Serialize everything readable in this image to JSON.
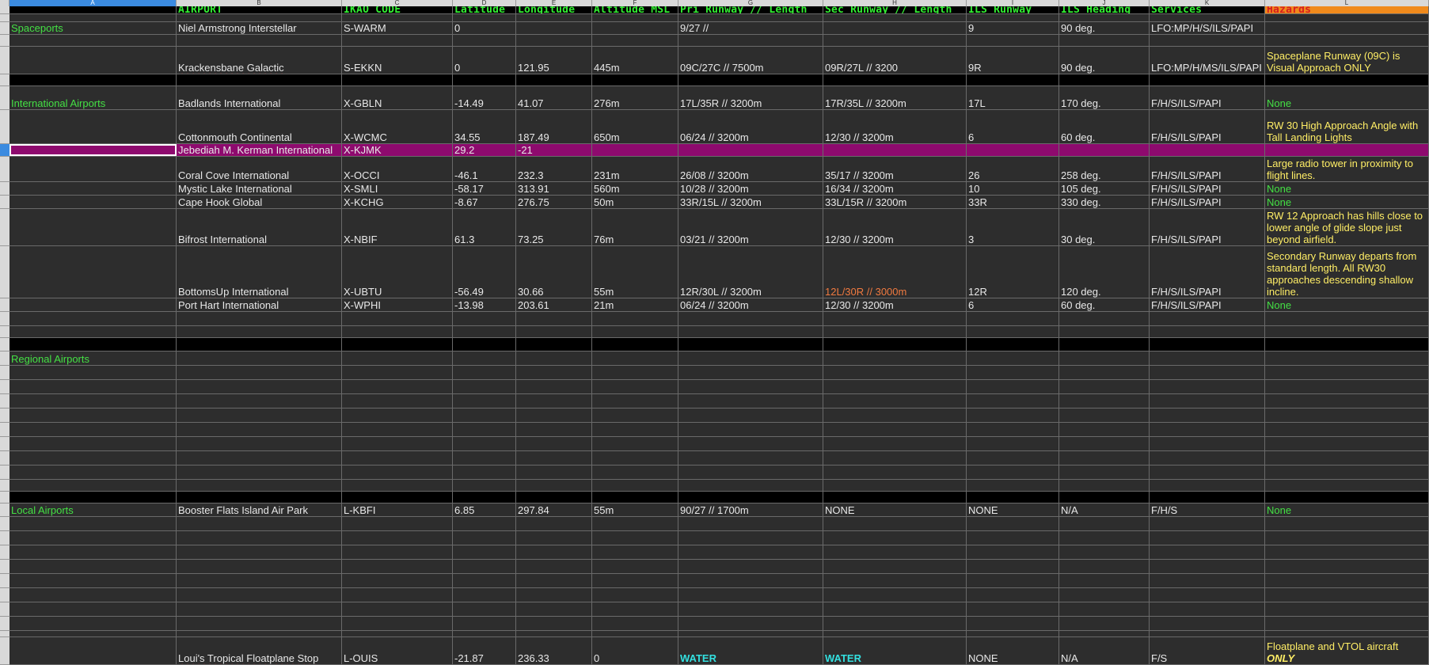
{
  "columns": [
    "A",
    "B",
    "C",
    "D",
    "E",
    "F",
    "G",
    "H",
    "I",
    "J",
    "K",
    "L"
  ],
  "headers": {
    "airport": "AIRPORT",
    "ikao": "IKAO CODE",
    "lat": "Latitude",
    "lon": "Longitude",
    "alt": "Altitude MSL",
    "pri": "Pri Runway // Length",
    "sec": "Sec Runway // Length",
    "ils_rw": "ILS Runway",
    "ils_hd": "ILS Heading",
    "services": "Services",
    "hazards": "Hazards"
  },
  "categories": {
    "spaceports": "Spaceports",
    "international": "International Airports",
    "regional": "Regional Airports",
    "local": "Local Airports"
  },
  "airports": [
    {
      "name": "Niel Armstrong Interstellar",
      "code": "S-WARM",
      "lat": "0",
      "lon": "",
      "alt": "",
      "pri": "9/27 //",
      "sec": "",
      "ils_rw": "9",
      "ils_hd": "90 deg.",
      "services": "LFO:MP/H/S/ILS/PAPI",
      "hazard": ""
    },
    {
      "name": "Krackensbane Galactic",
      "code": "S-EKKN",
      "lat": "0",
      "lon": "121.95",
      "alt": "445m",
      "pri": "09C/27C // 7500m",
      "sec": "09R/27L // 3200",
      "ils_rw": "9R",
      "ils_hd": "90 deg.",
      "services": "LFO:MP/H/MS/ILS/PAPI",
      "hazard": "Spaceplane Runway (09C) is Visual Approach ONLY"
    },
    {
      "name": "Badlands International",
      "code": "X-GBLN",
      "lat": "-14.49",
      "lon": "41.07",
      "alt": "276m",
      "pri": "17L/35R  //  3200m",
      "sec": "17R/35L // 3200m",
      "ils_rw": "17L",
      "ils_hd": "170 deg.",
      "services": "F/H/S/ILS/PAPI",
      "hazard": "None"
    },
    {
      "name": "Cottonmouth Continental",
      "code": "X-WCMC",
      "lat": "34.55",
      "lon": "187.49",
      "alt": "650m",
      "pri": "06/24 // 3200m",
      "sec": "12/30 // 3200m",
      "ils_rw": "6",
      "ils_hd": "60 deg.",
      "services": "F/H/S/ILS/PAPI",
      "hazard": "RW 30 High Approach Angle with Tall Landing Lights"
    },
    {
      "name": "Jebediah M. Kerman International",
      "code": "X-KJMK",
      "lat": "29.2",
      "lon": "-21",
      "alt": "",
      "pri": "",
      "sec": "",
      "ils_rw": "",
      "ils_hd": "",
      "services": "",
      "hazard": ""
    },
    {
      "name": "Coral Cove International",
      "code": "X-OCCI",
      "lat": "-46.1",
      "lon": "232.3",
      "alt": "231m",
      "pri": "26/08 // 3200m",
      "sec": "35/17 // 3200m",
      "ils_rw": "26",
      "ils_hd": "258 deg.",
      "services": "F/H/S/ILS/PAPI",
      "hazard": "Large radio tower in proximity to flight lines."
    },
    {
      "name": "Mystic Lake International",
      "code": "X-SMLI",
      "lat": "-58.17",
      "lon": "313.91",
      "alt": "560m",
      "pri": "10/28 // 3200m",
      "sec": "16/34 // 3200m",
      "ils_rw": "10",
      "ils_hd": "105 deg.",
      "services": "F/H/S/ILS/PAPI",
      "hazard": "None"
    },
    {
      "name": "Cape Hook Global",
      "code": "X-KCHG",
      "lat": "-8.67",
      "lon": "276.75",
      "alt": "50m",
      "pri": "33R/15L // 3200m",
      "sec": "33L/15R // 3200m",
      "ils_rw": "33R",
      "ils_hd": "330 deg.",
      "services": "F/H/S/ILS/PAPI",
      "hazard": "None"
    },
    {
      "name": "Bifrost International",
      "code": "X-NBIF",
      "lat": "61.3",
      "lon": "73.25",
      "alt": "76m",
      "pri": "03/21 // 3200m",
      "sec": "12/30 // 3200m",
      "ils_rw": "3",
      "ils_hd": "30 deg.",
      "services": "F/H/S/ILS/PAPI",
      "hazard": "RW 12 Approach has hills close to lower angle of glide slope just beyond airfield."
    },
    {
      "name": "BottomsUp International",
      "code": "X-UBTU",
      "lat": "-56.49",
      "lon": "30.66",
      "alt": "55m",
      "pri": "12R/30L // 3200m",
      "sec": "12L/30R // 3000m",
      "ils_rw": "12R",
      "ils_hd": "120 deg.",
      "services": "F/H/S/ILS/PAPI",
      "hazard": "Secondary Runway departs from standard length.  All RW30 approaches descending shallow incline."
    },
    {
      "name": "Port Hart International",
      "code": "X-WPHI",
      "lat": "-13.98",
      "lon": "203.61",
      "alt": "21m",
      "pri": "06/24 // 3200m",
      "sec": "12/30 // 3200m",
      "ils_rw": "6",
      "ils_hd": "60 deg.",
      "services": "F/H/S/ILS/PAPI",
      "hazard": "None"
    },
    {
      "name": "Booster Flats Island Air Park",
      "code": "L-KBFI",
      "lat": "6.85",
      "lon": "297.84",
      "alt": "55m",
      "pri": "90/27 // 1700m",
      "sec": "NONE",
      "ils_rw": "NONE",
      "ils_hd": "N/A",
      "services": "F/H/S",
      "hazard": "None"
    },
    {
      "name": "Loui's Tropical Floatplane Stop",
      "code": "L-OUIS",
      "lat": "-21.87",
      "lon": "236.33",
      "alt": "0",
      "pri": "WATER",
      "sec": "WATER",
      "ils_rw": "NONE",
      "ils_hd": "N/A",
      "services": "F/S",
      "hazard": "Floatplane and VTOL aircraft",
      "hazard_emph": "ONLY"
    }
  ],
  "colors": {
    "header_green": "#33ee33",
    "hazard_header_bg": "#f08a1c",
    "hazard_header_text": "#d62020",
    "selected_row": "#8e0a6e",
    "note_yellow": "#ffee66",
    "none_green": "#44e044",
    "water_cyan": "#33e0e0",
    "warn_orange": "#f07a40"
  }
}
